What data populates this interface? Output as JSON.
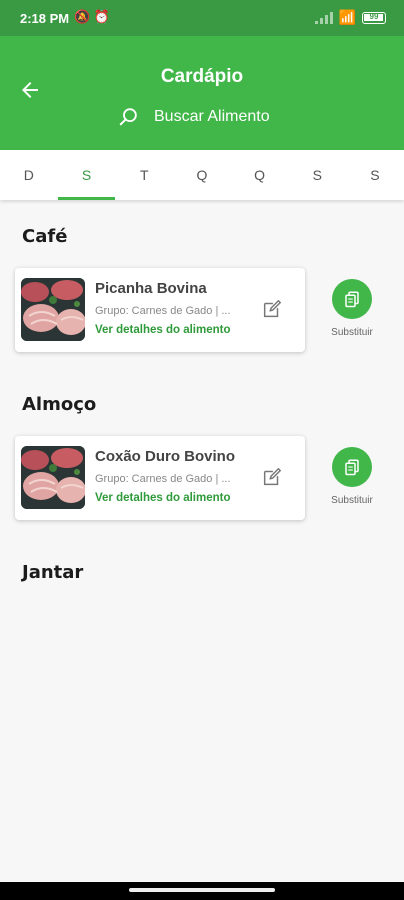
{
  "status_bar": {
    "time": "2:18 PM",
    "left_icons": [
      "mute-icon",
      "alarm-icon"
    ],
    "right_icons": [
      "signal-icon",
      "wifi-icon",
      "battery-icon"
    ],
    "battery_level": "99"
  },
  "header": {
    "title": "Cardápio",
    "search_placeholder": "Buscar Alimento"
  },
  "tabs": [
    {
      "label": "D",
      "active": false
    },
    {
      "label": "S",
      "active": true
    },
    {
      "label": "T",
      "active": false
    },
    {
      "label": "Q",
      "active": false
    },
    {
      "label": "Q",
      "active": false
    },
    {
      "label": "S",
      "active": false
    },
    {
      "label": "S",
      "active": false
    }
  ],
  "meals": [
    {
      "title": "Café",
      "items": [
        {
          "name": "Picanha Bovina",
          "group": "Grupo: Carnes de Gado | ...",
          "link": "Ver detalhes do alimento",
          "substitute_label": "Substituir"
        }
      ]
    },
    {
      "title": "Almoço",
      "items": [
        {
          "name": "Coxão Duro Bovino",
          "group": "Grupo: Carnes de Gado | ...",
          "link": "Ver detalhes do alimento",
          "substitute_label": "Substituir"
        }
      ]
    },
    {
      "title": "Jantar",
      "items": []
    }
  ],
  "colors": {
    "primary": "#41b649",
    "primary_dark": "#3a9a43",
    "link": "#2f9a3a"
  }
}
